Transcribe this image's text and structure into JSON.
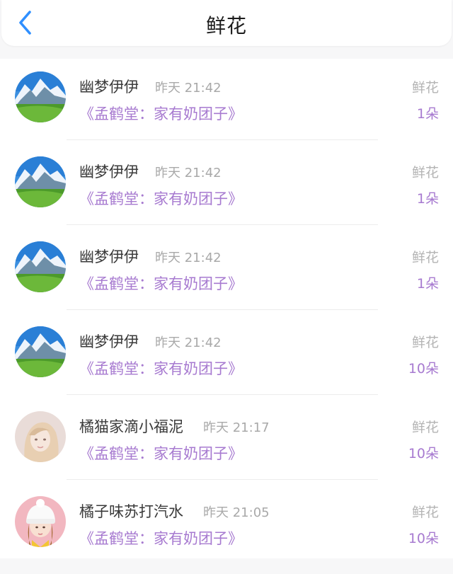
{
  "header": {
    "title": "鲜花",
    "back_icon": "chevron-left-icon",
    "accent": "#2f8fff"
  },
  "colors": {
    "book_link": "#a77ad0",
    "muted": "#a9a9a9"
  },
  "items": [
    {
      "avatar": "mountain-landscape-avatar",
      "name": "幽梦伊伊",
      "time": "昨天 21:42",
      "book": "《孟鹤堂：家有奶团子》",
      "gift": "鲜花",
      "qty": "1朵"
    },
    {
      "avatar": "mountain-landscape-avatar",
      "name": "幽梦伊伊",
      "time": "昨天 21:42",
      "book": "《孟鹤堂：家有奶团子》",
      "gift": "鲜花",
      "qty": "1朵"
    },
    {
      "avatar": "mountain-landscape-avatar",
      "name": "幽梦伊伊",
      "time": "昨天 21:42",
      "book": "《孟鹤堂：家有奶团子》",
      "gift": "鲜花",
      "qty": "1朵"
    },
    {
      "avatar": "mountain-landscape-avatar",
      "name": "幽梦伊伊",
      "time": "昨天 21:42",
      "book": "《孟鹤堂：家有奶团子》",
      "gift": "鲜花",
      "qty": "10朵"
    },
    {
      "avatar": "blonde-girl-avatar",
      "name": "橘猫家滴小福泥",
      "time": "昨天 21:17",
      "book": "《孟鹤堂：家有奶团子》",
      "gift": "鲜花",
      "qty": "10朵"
    },
    {
      "avatar": "girl-with-beanie-avatar",
      "name": "橘子味苏打汽水",
      "time": "昨天 21:05",
      "book": "《孟鹤堂：家有奶团子》",
      "gift": "鲜花",
      "qty": "10朵"
    }
  ]
}
